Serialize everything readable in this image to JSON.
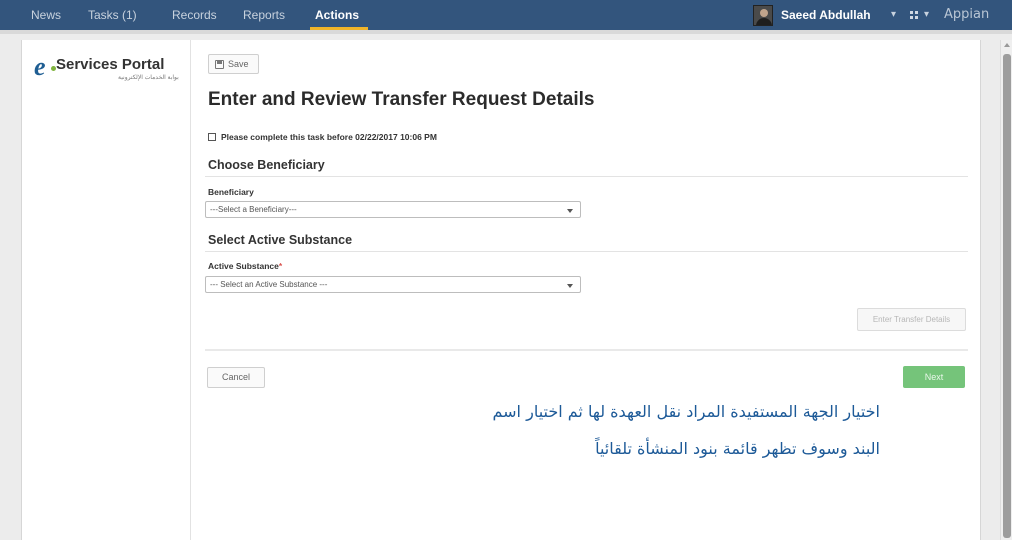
{
  "nav": {
    "items": [
      {
        "label": "News",
        "active": false
      },
      {
        "label": "Tasks (1)",
        "active": false
      },
      {
        "label": "Records",
        "active": false
      },
      {
        "label": "Reports",
        "active": false
      },
      {
        "label": "Actions",
        "active": true
      }
    ],
    "user_name": "Saeed Abdullah",
    "user_caret": "▾",
    "apps_caret": "▾",
    "brand": "Appian"
  },
  "logo": {
    "text": "Services Portal",
    "subtitle": "بوابة الخدمات الإلكترونية"
  },
  "form": {
    "save_label": "Save",
    "title": "Enter and Review Transfer Request Details",
    "deadline": "Please complete this task before 02/22/2017 10:06 PM",
    "section_beneficiary": "Choose Beneficiary",
    "beneficiary_label": "Beneficiary",
    "beneficiary_value": "---Select a Beneficiary---",
    "section_substance": "Select Active Substance",
    "substance_label": "Active Substance",
    "substance_required": "*",
    "substance_value": "--- Select an Active Substance ---",
    "enter_details_label": "Enter Transfer Details",
    "cancel_label": "Cancel",
    "next_label": "Next"
  },
  "annotation": {
    "line1": "اختيار الجهة المستفيدة المراد نقل العهدة لها ثم اختيار اسم",
    "line2": "البند وسوف تظهر قائمة بنود المنشأة تلقائياً"
  },
  "colors": {
    "topbar": "#33557d",
    "active_tab_underline": "#f0b429",
    "primary_button": "#75c47a",
    "annotation_text": "#1d5a98",
    "logo_blue": "#1f5e93",
    "logo_green": "#7fb33d"
  }
}
